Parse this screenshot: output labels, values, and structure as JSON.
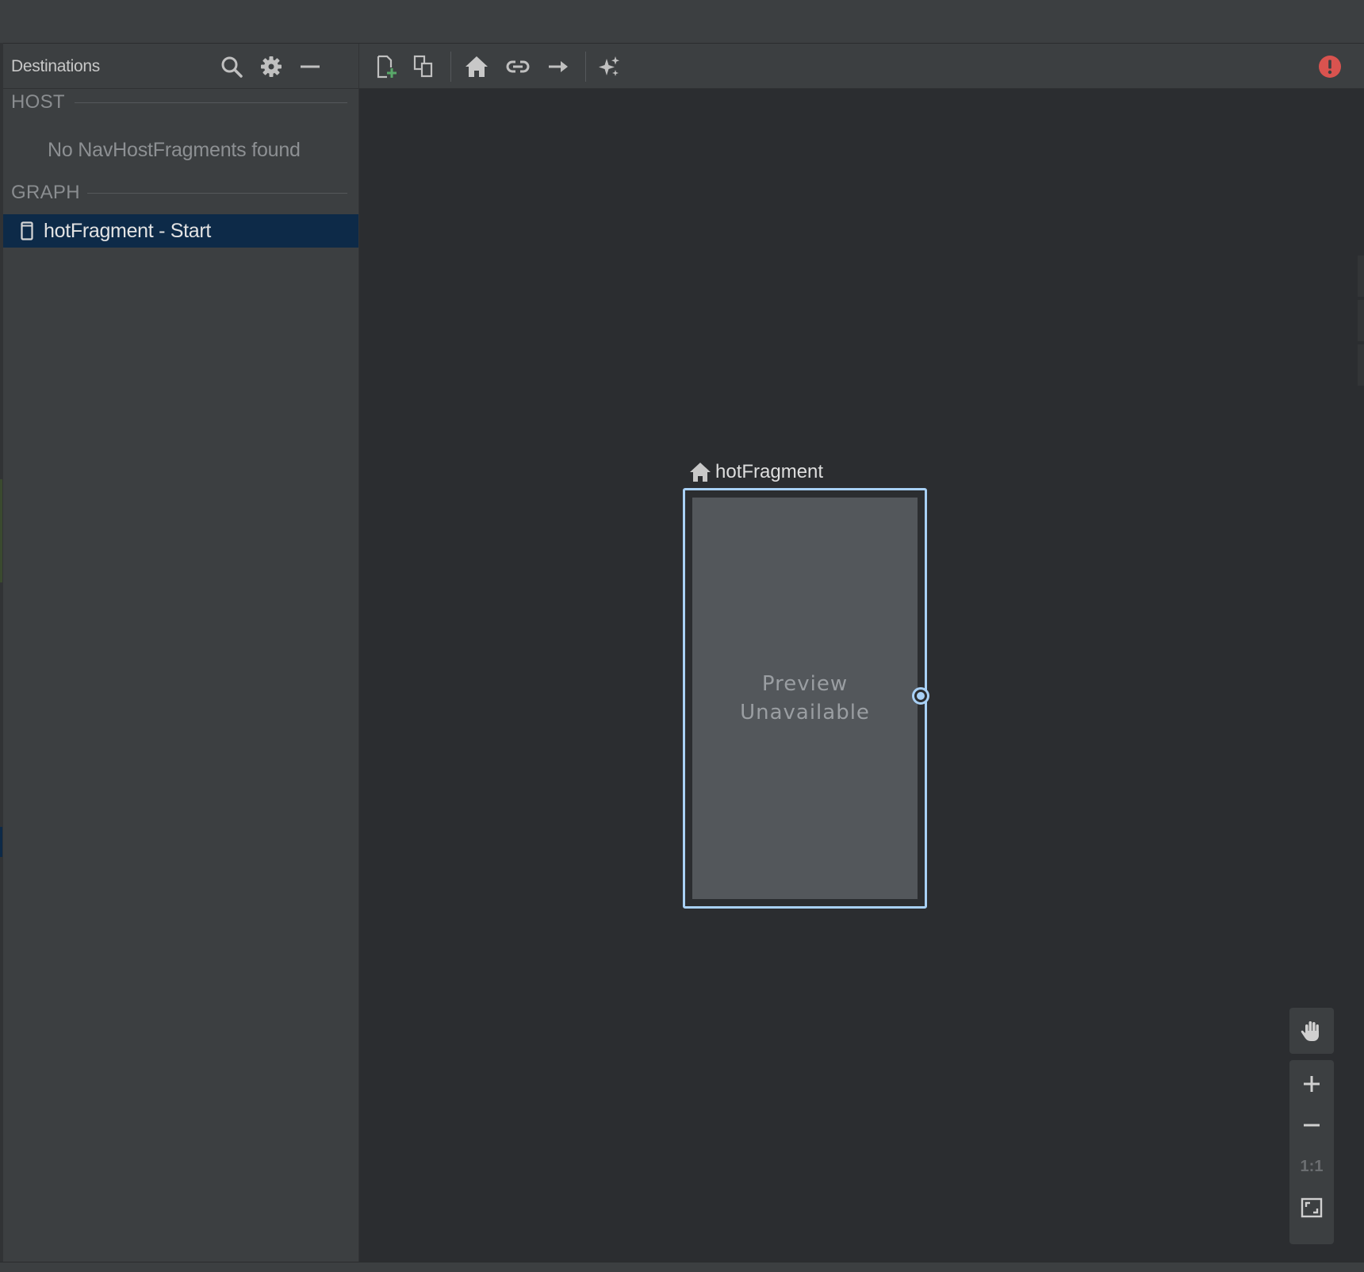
{
  "panel": {
    "title": "Destinations",
    "host_section": "HOST",
    "host_empty": "No NavHostFragments found",
    "graph_section": "GRAPH",
    "graph_items": [
      {
        "label": "hotFragment - Start",
        "icon": "device-icon",
        "selected": true
      }
    ],
    "header_icons": [
      "search-icon",
      "gear-icon",
      "minimize-icon"
    ]
  },
  "toolbar": {
    "buttons": [
      "new-destination-icon",
      "nested-graph-icon",
      "assign-start-destination-icon",
      "deep-link-icon",
      "add-action-icon",
      "auto-arrange-icon"
    ],
    "status": "error-icon"
  },
  "graph": {
    "fragment_name": "hotFragment",
    "preview_text": "Preview\nUnavailable"
  },
  "zoom_panel": {
    "buttons": [
      "pan-icon",
      "zoom-in-icon",
      "zoom-out-icon",
      "actual-size",
      "zoom-to-fit-icon"
    ],
    "actual_size_label": "1:1"
  },
  "colors": {
    "background": "#2b2d30",
    "panel": "#3c3f41",
    "selection": "#0d2a48",
    "accent": "#a8d0f5",
    "error": "#d9534f",
    "add_green": "#59a869"
  }
}
